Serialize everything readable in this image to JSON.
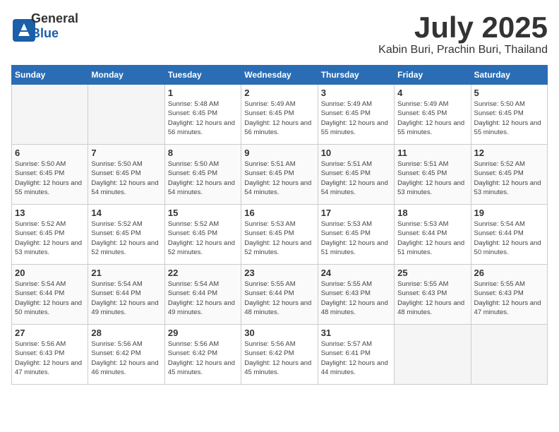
{
  "header": {
    "logo_general": "General",
    "logo_blue": "Blue",
    "month_title": "July 2025",
    "location": "Kabin Buri, Prachin Buri, Thailand"
  },
  "days_of_week": [
    "Sunday",
    "Monday",
    "Tuesday",
    "Wednesday",
    "Thursday",
    "Friday",
    "Saturday"
  ],
  "weeks": [
    [
      {
        "day": "",
        "empty": true
      },
      {
        "day": "",
        "empty": true
      },
      {
        "day": "1",
        "sunrise": "Sunrise: 5:48 AM",
        "sunset": "Sunset: 6:45 PM",
        "daylight": "Daylight: 12 hours and 56 minutes."
      },
      {
        "day": "2",
        "sunrise": "Sunrise: 5:49 AM",
        "sunset": "Sunset: 6:45 PM",
        "daylight": "Daylight: 12 hours and 56 minutes."
      },
      {
        "day": "3",
        "sunrise": "Sunrise: 5:49 AM",
        "sunset": "Sunset: 6:45 PM",
        "daylight": "Daylight: 12 hours and 55 minutes."
      },
      {
        "day": "4",
        "sunrise": "Sunrise: 5:49 AM",
        "sunset": "Sunset: 6:45 PM",
        "daylight": "Daylight: 12 hours and 55 minutes."
      },
      {
        "day": "5",
        "sunrise": "Sunrise: 5:50 AM",
        "sunset": "Sunset: 6:45 PM",
        "daylight": "Daylight: 12 hours and 55 minutes."
      }
    ],
    [
      {
        "day": "6",
        "sunrise": "Sunrise: 5:50 AM",
        "sunset": "Sunset: 6:45 PM",
        "daylight": "Daylight: 12 hours and 55 minutes."
      },
      {
        "day": "7",
        "sunrise": "Sunrise: 5:50 AM",
        "sunset": "Sunset: 6:45 PM",
        "daylight": "Daylight: 12 hours and 54 minutes."
      },
      {
        "day": "8",
        "sunrise": "Sunrise: 5:50 AM",
        "sunset": "Sunset: 6:45 PM",
        "daylight": "Daylight: 12 hours and 54 minutes."
      },
      {
        "day": "9",
        "sunrise": "Sunrise: 5:51 AM",
        "sunset": "Sunset: 6:45 PM",
        "daylight": "Daylight: 12 hours and 54 minutes."
      },
      {
        "day": "10",
        "sunrise": "Sunrise: 5:51 AM",
        "sunset": "Sunset: 6:45 PM",
        "daylight": "Daylight: 12 hours and 54 minutes."
      },
      {
        "day": "11",
        "sunrise": "Sunrise: 5:51 AM",
        "sunset": "Sunset: 6:45 PM",
        "daylight": "Daylight: 12 hours and 53 minutes."
      },
      {
        "day": "12",
        "sunrise": "Sunrise: 5:52 AM",
        "sunset": "Sunset: 6:45 PM",
        "daylight": "Daylight: 12 hours and 53 minutes."
      }
    ],
    [
      {
        "day": "13",
        "sunrise": "Sunrise: 5:52 AM",
        "sunset": "Sunset: 6:45 PM",
        "daylight": "Daylight: 12 hours and 53 minutes."
      },
      {
        "day": "14",
        "sunrise": "Sunrise: 5:52 AM",
        "sunset": "Sunset: 6:45 PM",
        "daylight": "Daylight: 12 hours and 52 minutes."
      },
      {
        "day": "15",
        "sunrise": "Sunrise: 5:52 AM",
        "sunset": "Sunset: 6:45 PM",
        "daylight": "Daylight: 12 hours and 52 minutes."
      },
      {
        "day": "16",
        "sunrise": "Sunrise: 5:53 AM",
        "sunset": "Sunset: 6:45 PM",
        "daylight": "Daylight: 12 hours and 52 minutes."
      },
      {
        "day": "17",
        "sunrise": "Sunrise: 5:53 AM",
        "sunset": "Sunset: 6:45 PM",
        "daylight": "Daylight: 12 hours and 51 minutes."
      },
      {
        "day": "18",
        "sunrise": "Sunrise: 5:53 AM",
        "sunset": "Sunset: 6:44 PM",
        "daylight": "Daylight: 12 hours and 51 minutes."
      },
      {
        "day": "19",
        "sunrise": "Sunrise: 5:54 AM",
        "sunset": "Sunset: 6:44 PM",
        "daylight": "Daylight: 12 hours and 50 minutes."
      }
    ],
    [
      {
        "day": "20",
        "sunrise": "Sunrise: 5:54 AM",
        "sunset": "Sunset: 6:44 PM",
        "daylight": "Daylight: 12 hours and 50 minutes."
      },
      {
        "day": "21",
        "sunrise": "Sunrise: 5:54 AM",
        "sunset": "Sunset: 6:44 PM",
        "daylight": "Daylight: 12 hours and 49 minutes."
      },
      {
        "day": "22",
        "sunrise": "Sunrise: 5:54 AM",
        "sunset": "Sunset: 6:44 PM",
        "daylight": "Daylight: 12 hours and 49 minutes."
      },
      {
        "day": "23",
        "sunrise": "Sunrise: 5:55 AM",
        "sunset": "Sunset: 6:44 PM",
        "daylight": "Daylight: 12 hours and 48 minutes."
      },
      {
        "day": "24",
        "sunrise": "Sunrise: 5:55 AM",
        "sunset": "Sunset: 6:43 PM",
        "daylight": "Daylight: 12 hours and 48 minutes."
      },
      {
        "day": "25",
        "sunrise": "Sunrise: 5:55 AM",
        "sunset": "Sunset: 6:43 PM",
        "daylight": "Daylight: 12 hours and 48 minutes."
      },
      {
        "day": "26",
        "sunrise": "Sunrise: 5:55 AM",
        "sunset": "Sunset: 6:43 PM",
        "daylight": "Daylight: 12 hours and 47 minutes."
      }
    ],
    [
      {
        "day": "27",
        "sunrise": "Sunrise: 5:56 AM",
        "sunset": "Sunset: 6:43 PM",
        "daylight": "Daylight: 12 hours and 47 minutes."
      },
      {
        "day": "28",
        "sunrise": "Sunrise: 5:56 AM",
        "sunset": "Sunset: 6:42 PM",
        "daylight": "Daylight: 12 hours and 46 minutes."
      },
      {
        "day": "29",
        "sunrise": "Sunrise: 5:56 AM",
        "sunset": "Sunset: 6:42 PM",
        "daylight": "Daylight: 12 hours and 45 minutes."
      },
      {
        "day": "30",
        "sunrise": "Sunrise: 5:56 AM",
        "sunset": "Sunset: 6:42 PM",
        "daylight": "Daylight: 12 hours and 45 minutes."
      },
      {
        "day": "31",
        "sunrise": "Sunrise: 5:57 AM",
        "sunset": "Sunset: 6:41 PM",
        "daylight": "Daylight: 12 hours and 44 minutes."
      },
      {
        "day": "",
        "empty": true
      },
      {
        "day": "",
        "empty": true
      }
    ]
  ]
}
